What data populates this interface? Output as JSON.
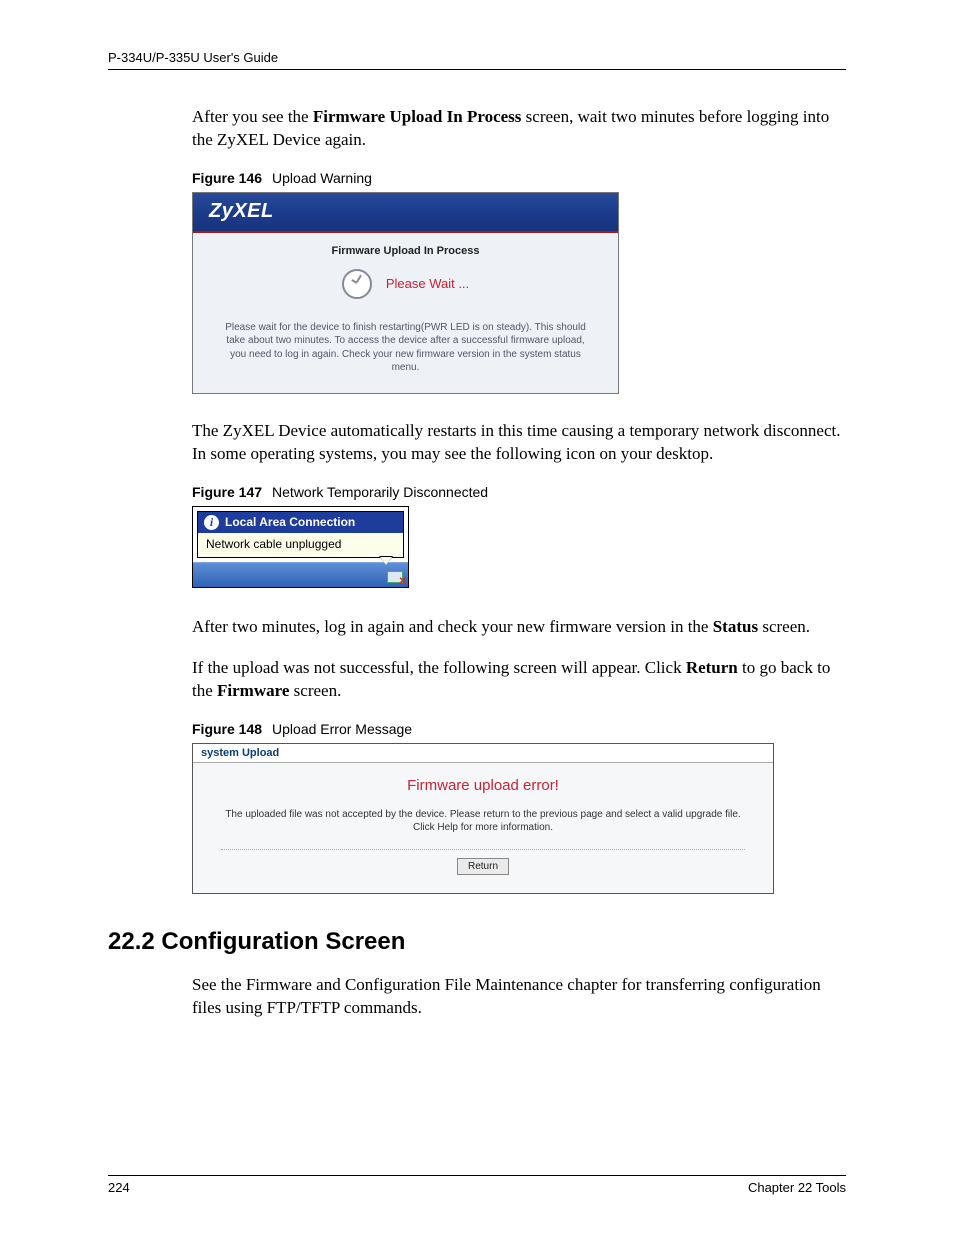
{
  "header": {
    "guide_title": "P-334U/P-335U User's Guide"
  },
  "footer": {
    "page_number": "224",
    "chapter": "Chapter 22 Tools"
  },
  "paragraphs": {
    "p1a": "After you see the ",
    "p1b": "Firmware Upload In Process",
    "p1c": " screen, wait two minutes before logging into the ZyXEL Device again.",
    "p2": "The ZyXEL Device automatically restarts in this time causing a temporary network disconnect. In some operating systems, you may see the following icon on your desktop.",
    "p3a": "After two minutes, log in again and check your new firmware version in the ",
    "p3b": "Status",
    "p3c": " screen.",
    "p4a": "If the upload was not successful, the following screen will appear. Click ",
    "p4b": "Return",
    "p4c": " to go back to the ",
    "p4d": "Firmware",
    "p4e": " screen.",
    "p5": "See the Firmware and Configuration File Maintenance chapter for transferring configuration files using FTP/TFTP commands."
  },
  "figures": {
    "f146": {
      "num": "Figure 146",
      "caption": "Upload Warning",
      "brand": "ZyXEL",
      "title": "Firmware Upload In Process",
      "wait": "Please Wait ...",
      "message": "Please wait for the device to finish restarting(PWR LED is on steady). This should take about two minutes. To access the device after a successful firmware upload, you need to log in again. Check your new firmware version in the system status menu."
    },
    "f147": {
      "num": "Figure 147",
      "caption": "Network Temporarily Disconnected",
      "balloon_title": "Local Area Connection",
      "balloon_body": "Network cable unplugged",
      "info_glyph": "i"
    },
    "f148": {
      "num": "Figure 148",
      "caption": "Upload Error Message",
      "tab": "system Upload",
      "error": "Firmware upload error!",
      "desc": "The uploaded file was not accepted by the device. Please return to the previous page and select a valid upgrade file. Click Help for more information.",
      "button": "Return"
    }
  },
  "section": {
    "heading": "22.2  Configuration Screen"
  }
}
